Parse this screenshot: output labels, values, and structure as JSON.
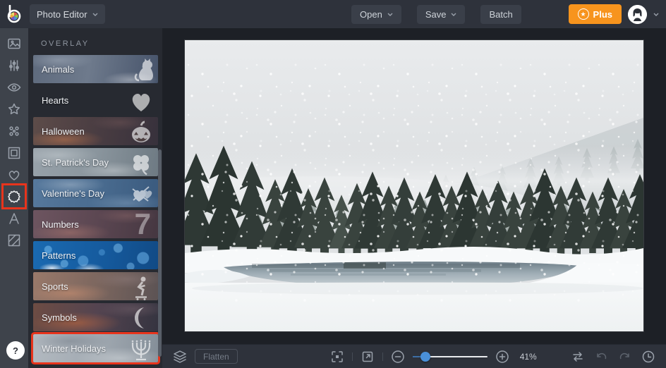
{
  "colors": {
    "topbar": "#2e323b",
    "sidebar": "#3e434b",
    "panel": "#272a31",
    "canvas_bg": "#1d2026",
    "highlight_red": "#e8341c",
    "accent_orange": "#f7941d",
    "slider_blue": "#4a90d9"
  },
  "topbar": {
    "logo_icon": "befunky-logo",
    "app_menu": {
      "label": "Photo Editor",
      "icon": "chevron-down-icon"
    },
    "open_button": "Open",
    "save_button": "Save",
    "batch_button": "Batch",
    "plus_button": {
      "label": "Plus",
      "icon": "star-icon"
    },
    "avatar_icon": "user-avatar",
    "avatar_chevron": "chevron-down-icon"
  },
  "sidebar": {
    "tools": [
      {
        "name": "image",
        "active": false,
        "highlighted": false
      },
      {
        "name": "adjust",
        "active": false,
        "highlighted": false
      },
      {
        "name": "touchup",
        "active": false,
        "highlighted": false
      },
      {
        "name": "effects",
        "active": false,
        "highlighted": false
      },
      {
        "name": "artsy",
        "active": false,
        "highlighted": false
      },
      {
        "name": "frames",
        "active": false,
        "highlighted": false
      },
      {
        "name": "graphics",
        "active": false,
        "highlighted": false
      },
      {
        "name": "overlays",
        "active": true,
        "highlighted": true
      },
      {
        "name": "text",
        "active": false,
        "highlighted": false
      },
      {
        "name": "textures",
        "active": false,
        "highlighted": false
      }
    ],
    "help_label": "?"
  },
  "panel": {
    "title": "OVERLAY",
    "categories": [
      {
        "label": "Animals",
        "icon": "cat",
        "theme": "animals",
        "highlighted": false
      },
      {
        "label": "Hearts",
        "icon": "heart",
        "theme": "hearts",
        "highlighted": false
      },
      {
        "label": "Halloween",
        "icon": "pumpkin",
        "theme": "halloween",
        "highlighted": false
      },
      {
        "label": "St. Patrick's Day",
        "icon": "clover",
        "theme": "stpatrick",
        "highlighted": false
      },
      {
        "label": "Valentine's Day",
        "icon": "valentine",
        "theme": "valentine",
        "highlighted": false
      },
      {
        "label": "Numbers",
        "icon": "seven",
        "theme": "numbers",
        "highlighted": false
      },
      {
        "label": "Patterns",
        "icon": "none",
        "theme": "patterns",
        "highlighted": false
      },
      {
        "label": "Sports",
        "icon": "skater",
        "theme": "sports",
        "highlighted": false
      },
      {
        "label": "Symbols",
        "icon": "moon",
        "theme": "symbols",
        "highlighted": false
      },
      {
        "label": "Winter Holidays",
        "icon": "menorah",
        "theme": "winter",
        "highlighted": true
      }
    ],
    "numbers_glyph": "7"
  },
  "toolbar": {
    "layers_icon": "layers-icon",
    "flatten_button": "Flatten",
    "fit_icon": "fit-to-screen-icon",
    "resize_icon": "open-resize-icon",
    "zoom_out_icon": "zoom-out-icon",
    "zoom_in_icon": "zoom-in-icon",
    "zoom_value": "41%",
    "compare_icon": "compare-icon",
    "undo_icon": "undo-icon",
    "redo_icon": "redo-icon",
    "history_icon": "history-icon"
  }
}
